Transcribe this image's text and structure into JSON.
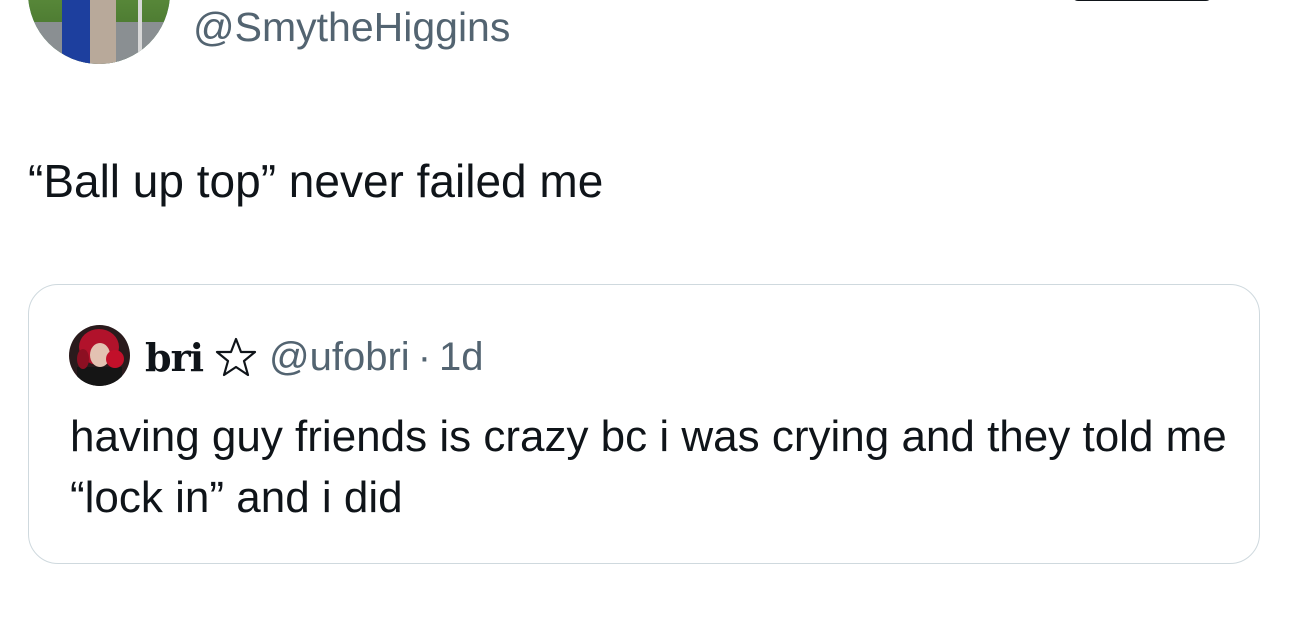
{
  "tweet": {
    "handle": "@SmytheHiggins",
    "text": "“Ball up top” never failed me"
  },
  "quote": {
    "name": "bri",
    "handle": "@ufobri",
    "separator": "·",
    "time": "1d",
    "text": "having guy friends is crazy bc i was crying and they told me “lock in” and i did"
  },
  "icons": {
    "main_avatar": "avatar-photo",
    "quote_avatar": "avatar-photo",
    "name_decoration": "star-outline-icon"
  },
  "colors": {
    "text_primary": "#0f1419",
    "text_secondary": "#536471",
    "border": "#cfd9de",
    "background": "#ffffff"
  }
}
